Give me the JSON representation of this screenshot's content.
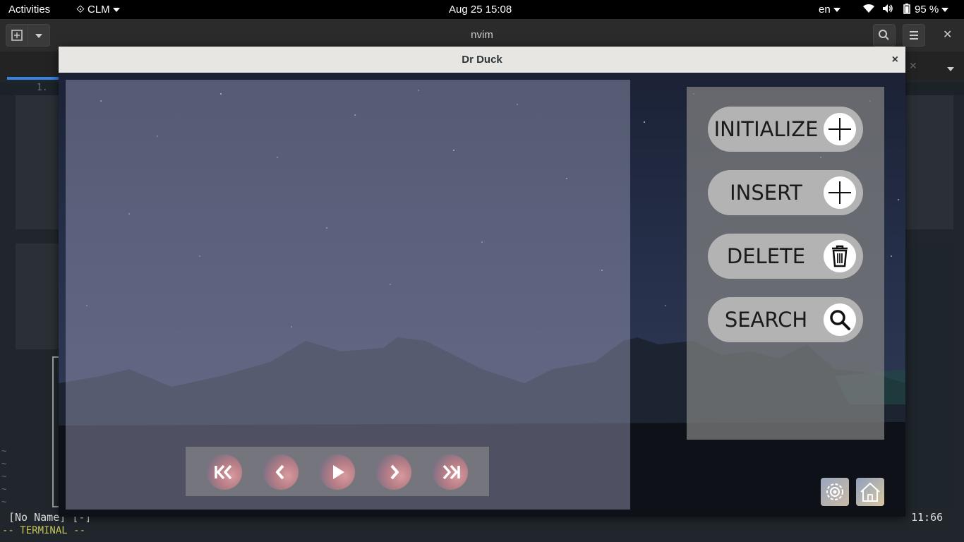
{
  "topbar": {
    "activities": "Activities",
    "app_menu": "CLM",
    "clock": "Aug 25  15:08",
    "keyboard": "en",
    "battery": "95 %"
  },
  "terminal": {
    "title": "nvim",
    "line_number": "1.",
    "status_left": "[No Name] [-]",
    "status_right": "11:66",
    "mode": "-- TERMINAL --"
  },
  "app": {
    "title": "Dr Duck",
    "close": "×",
    "actions": [
      {
        "label": "INITIALIZE",
        "icon": "plus-icon"
      },
      {
        "label": "INSERT",
        "icon": "plus-icon"
      },
      {
        "label": "DELETE",
        "icon": "trash-icon"
      },
      {
        "label": "SEARCH",
        "icon": "search-icon"
      }
    ],
    "playback": [
      "skip-to-start-icon",
      "previous-icon",
      "play-icon",
      "next-icon",
      "skip-to-end-icon"
    ],
    "corner_buttons": [
      "gear-icon",
      "home-icon"
    ]
  },
  "colors": {
    "titlebar": "#e8e6e3",
    "panel": "#828282",
    "pill": "#b3b3b3",
    "accent": "#3584e4"
  }
}
